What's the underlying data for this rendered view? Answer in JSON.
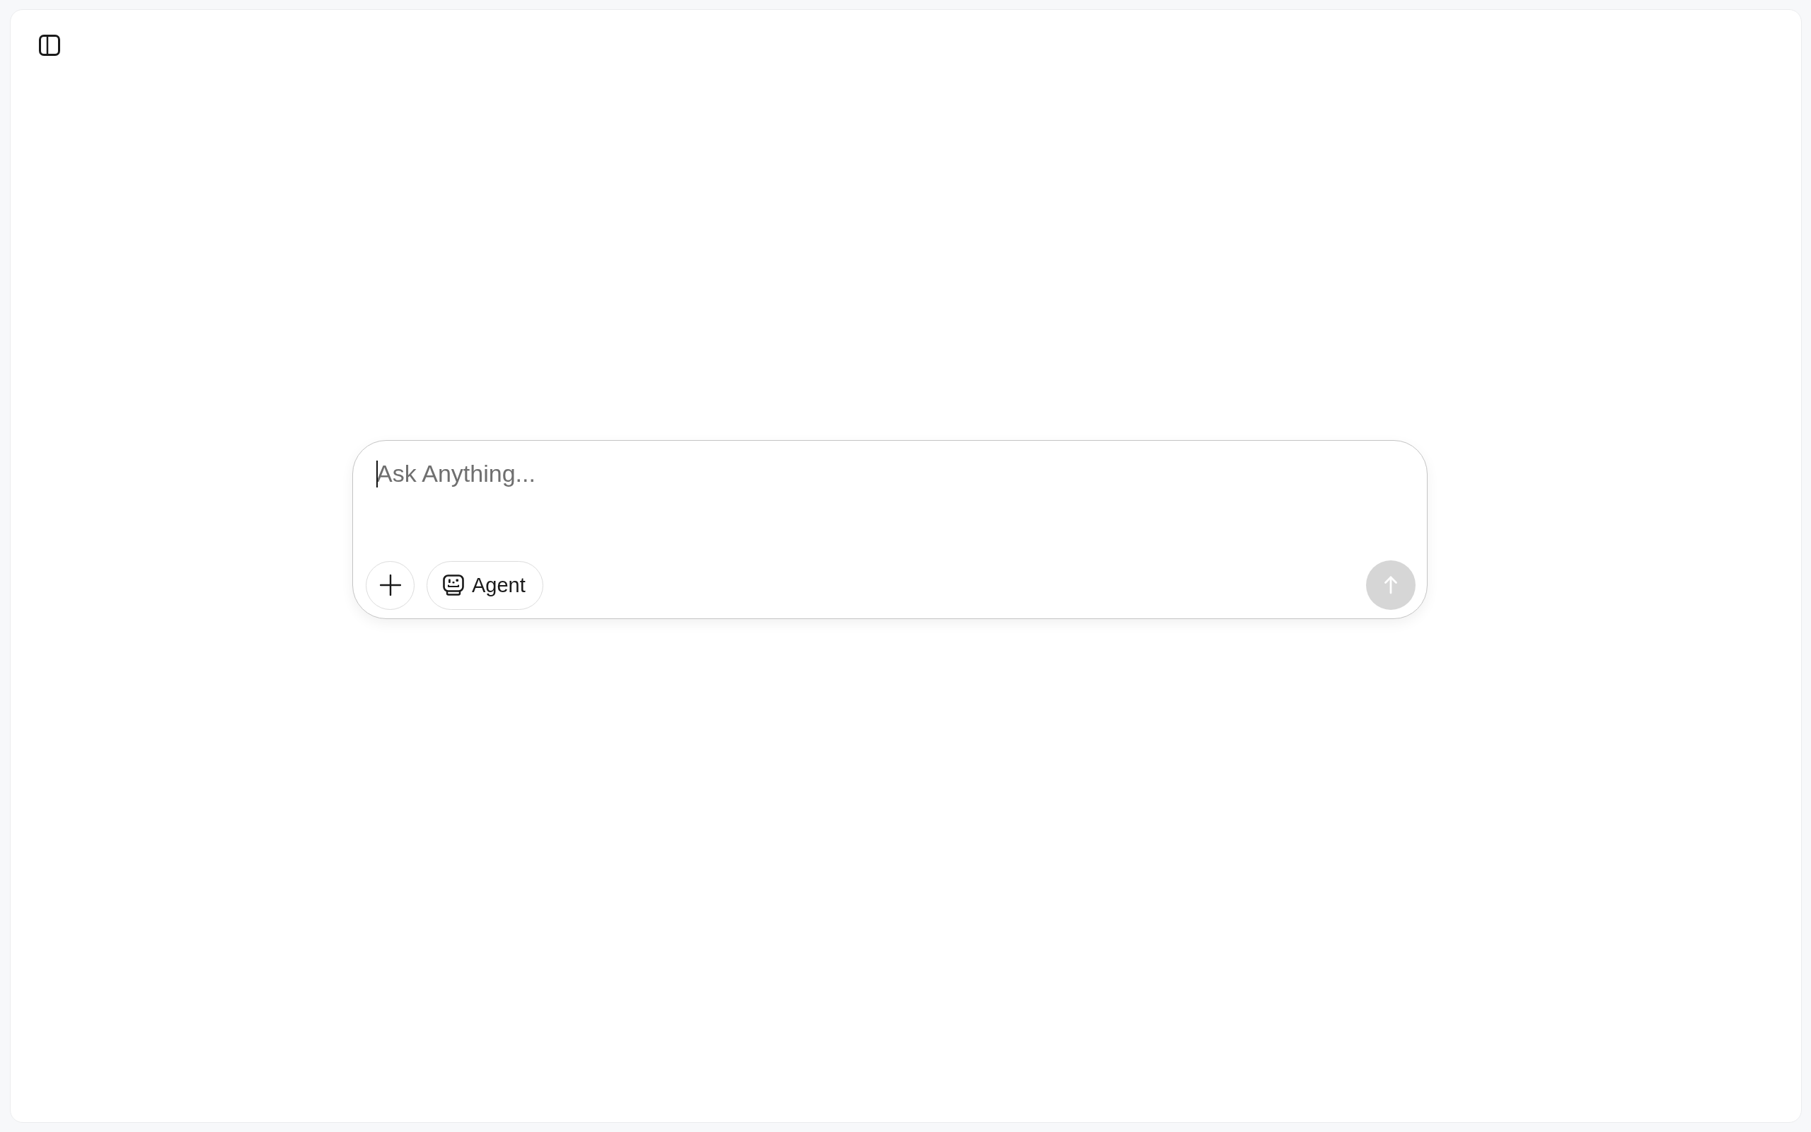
{
  "composer": {
    "input": {
      "placeholder": "Ask Anything...",
      "focused": true
    },
    "mode_button": {
      "label": "Agent"
    },
    "send_button": {
      "disabled": true
    }
  }
}
